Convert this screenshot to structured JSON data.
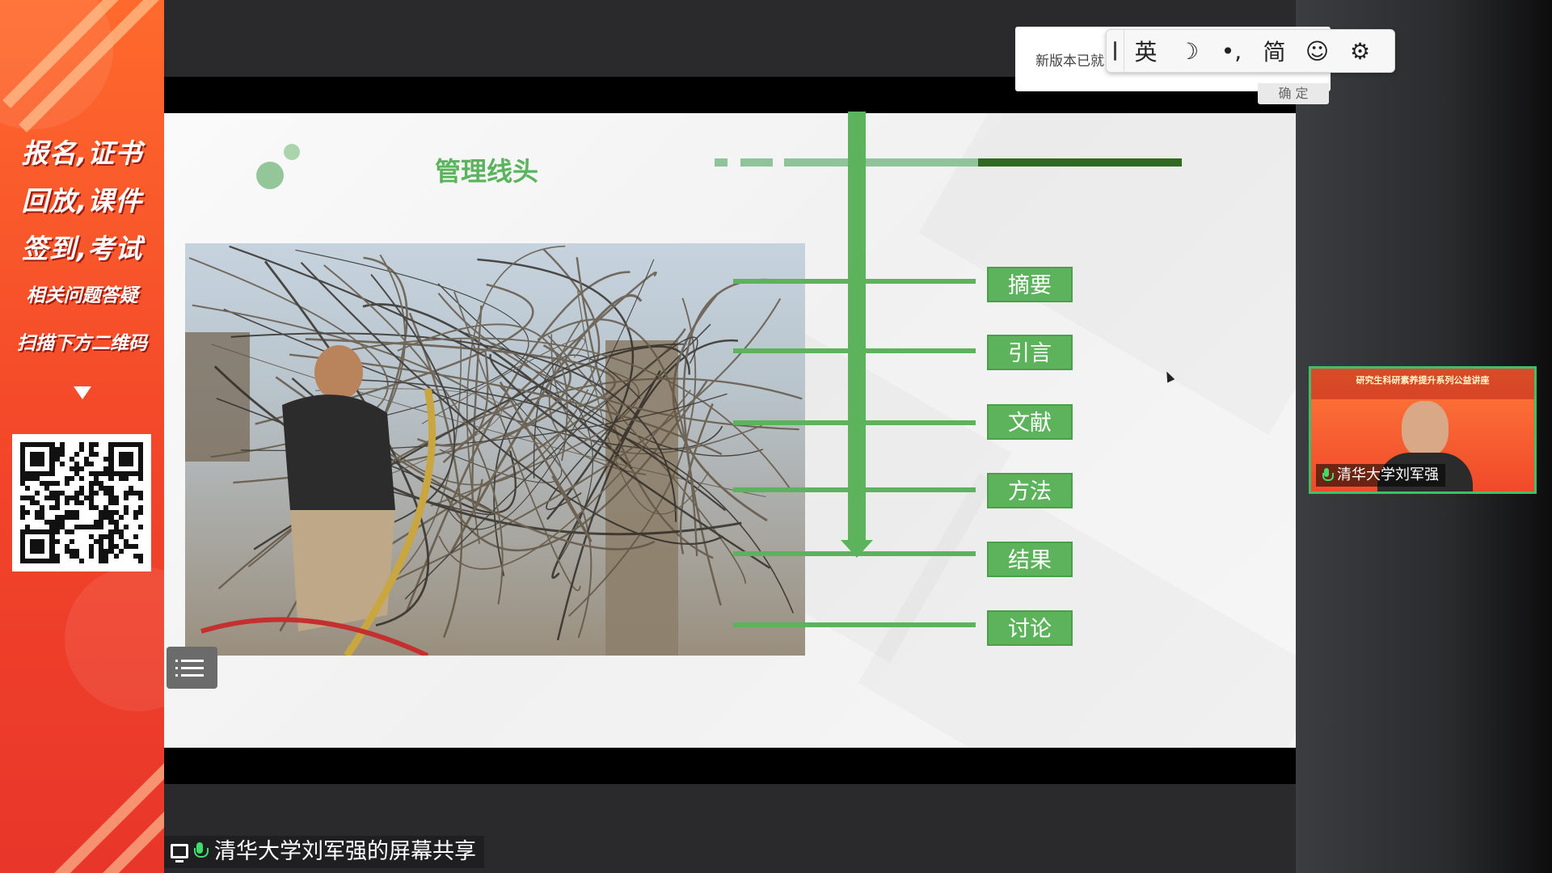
{
  "promo": {
    "line1": "报名,证书",
    "line2": "回放,课件",
    "line3": "签到,考试",
    "line4": "相关问题答疑",
    "line5": "扫描下方二维码"
  },
  "slide": {
    "title": "管理线头",
    "stages": [
      "摘要",
      "引言",
      "文献",
      "方法",
      "结果",
      "讨论"
    ],
    "colors": {
      "accent": "#5db35c",
      "title": "#5bb35d",
      "dark_bar": "#2f6a1f"
    }
  },
  "notice": {
    "text": "新版本已就",
    "confirm": "确 定"
  },
  "ime": {
    "buttons": [
      {
        "label": "英",
        "icon": "language-toggle"
      },
      {
        "label": "☽",
        "icon": "moon-icon"
      },
      {
        "label": "•,",
        "icon": "punctuation-icon"
      },
      {
        "label": "简",
        "icon": "simplified-icon"
      },
      {
        "label": "☺",
        "icon": "emoji-icon"
      },
      {
        "label": "⚙",
        "icon": "gear-icon"
      }
    ]
  },
  "video": {
    "banner": "研究生科研素养提升系列公益讲座",
    "name": "清华大学刘军强"
  },
  "share": {
    "label": "清华大学刘军强的屏幕共享"
  }
}
